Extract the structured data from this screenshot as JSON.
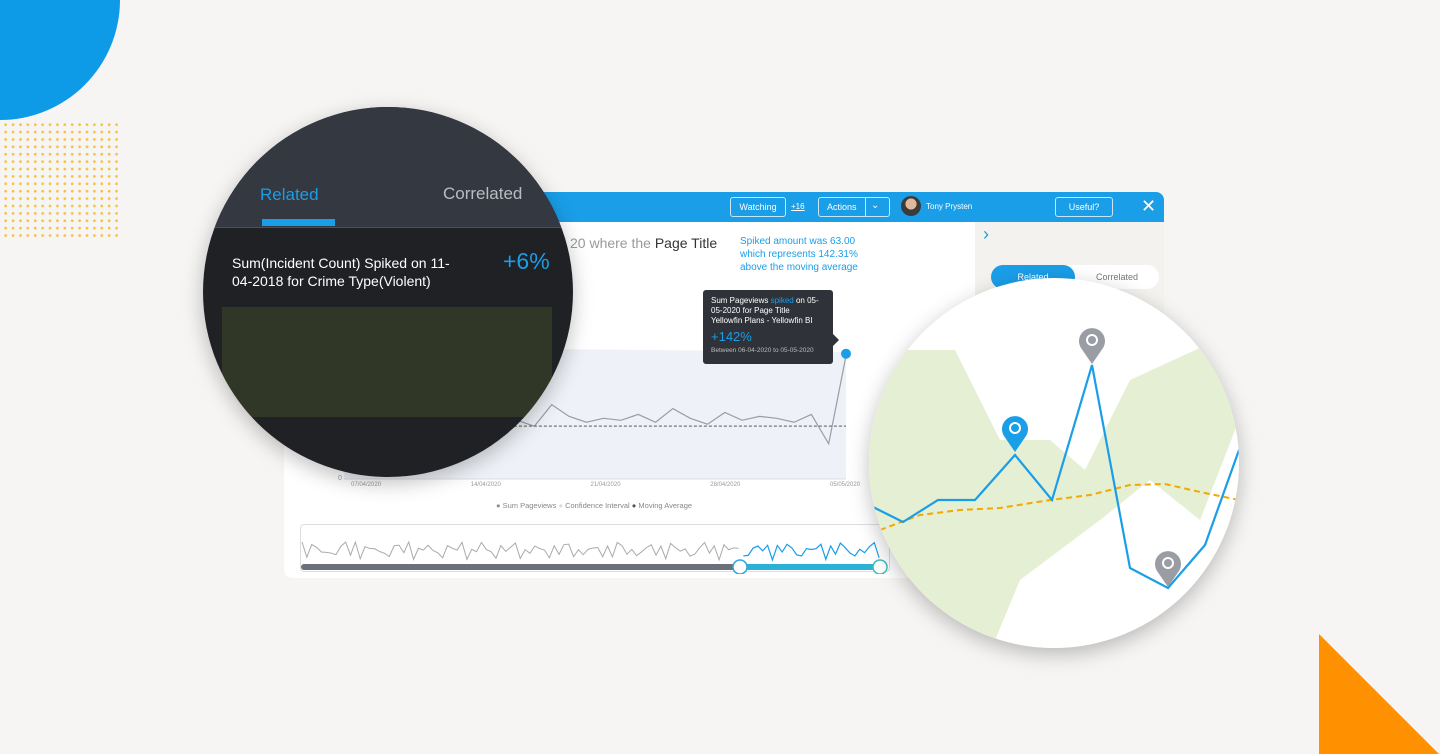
{
  "colors": {
    "brand": "#1a9ee8",
    "spark": "#b5d334",
    "orange": "#ff9000",
    "ci": "#e4efd3"
  },
  "header": {
    "watching": "Watching",
    "watch_count": "+16",
    "actions": "Actions",
    "user": "Tony Prysten",
    "useful": "Useful?"
  },
  "main": {
    "title_prefix": "20 where the ",
    "title_bold": "Page Title",
    "spike_note": [
      "Spiked amount was 63.00",
      "which represents 142.31%",
      "above the moving average"
    ]
  },
  "tooltip": {
    "line1a": "Sum Pageviews ",
    "line1b": "spiked",
    "line1c": " on 05-",
    "line2": "05-2020 for Page Title",
    "line3": "Yellowfin Plans - Yellowfin BI",
    "pct": "+142%",
    "range": "Between 06-04-2020 to 05-05-2020"
  },
  "right_panel": {
    "tabs": [
      "Related",
      "Correlated"
    ]
  },
  "chart_data": {
    "type": "line",
    "x_ticks": [
      "07/04/2020",
      "14/04/2020",
      "21/04/2020",
      "28/04/2020",
      "05/05/2020"
    ],
    "y_ticks": [
      "0"
    ],
    "ylim": [
      0,
      70
    ],
    "series": [
      {
        "name": "Sum Pageviews",
        "values": [
          34,
          30,
          33,
          36,
          29,
          26,
          31,
          35,
          28,
          33,
          30,
          27,
          38,
          32,
          29,
          31,
          30,
          33,
          29,
          36,
          31,
          28,
          34,
          30,
          32,
          31,
          29,
          33,
          18,
          63
        ]
      },
      {
        "name": "Moving Average",
        "values": [
          26,
          26,
          26,
          26,
          26,
          26,
          26,
          26,
          26,
          26,
          27,
          27,
          27,
          27,
          27,
          27,
          27,
          27,
          27,
          27,
          27,
          27,
          27,
          27,
          27,
          27,
          27,
          27,
          27,
          27
        ]
      }
    ],
    "legend": [
      "Sum Pageviews",
      "Confidence Interval",
      "Moving Average"
    ]
  },
  "insight": {
    "tabs": [
      "Related",
      "Correlated"
    ],
    "text": "Sum(Incident Count) Spiked on 11-04-2018 for Crime Type(Violent)",
    "pct": "+6%"
  }
}
